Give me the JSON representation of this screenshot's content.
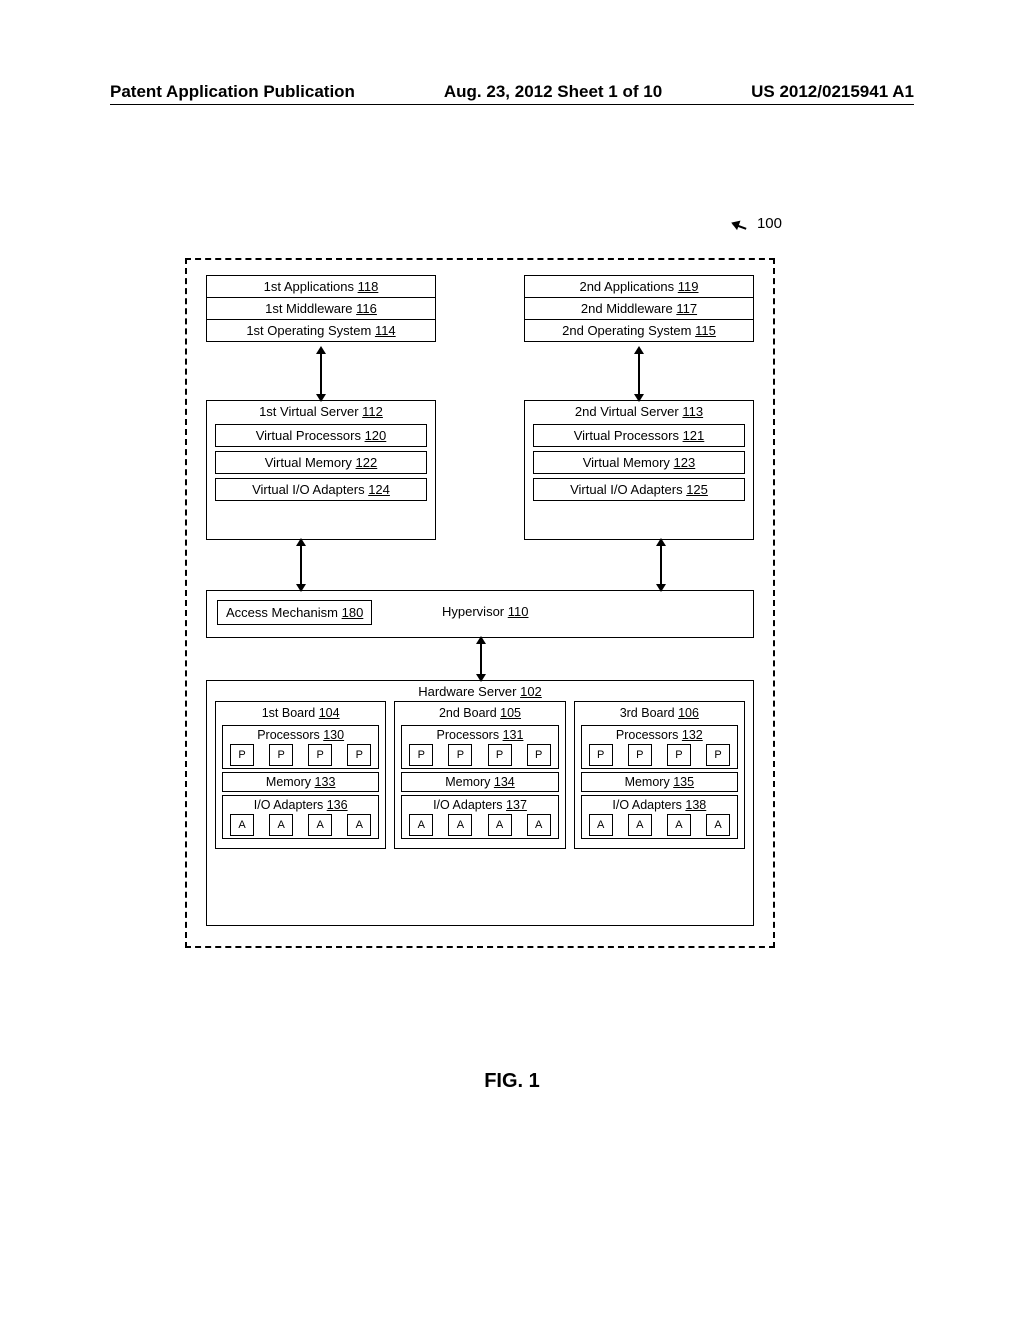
{
  "header": {
    "left": "Patent Application Publication",
    "center": "Aug. 23, 2012  Sheet 1 of 10",
    "right": "US 2012/0215941 A1"
  },
  "ref100": "100",
  "figure_label": "FIG. 1",
  "stacks": {
    "left": {
      "apps": {
        "label": "1st Applications",
        "num": "118"
      },
      "mw": {
        "label": "1st Middleware",
        "num": "116"
      },
      "os": {
        "label": "1st Operating System",
        "num": "114"
      }
    },
    "right": {
      "apps": {
        "label": "2nd Applications",
        "num": "119"
      },
      "mw": {
        "label": "2nd Middleware",
        "num": "117"
      },
      "os": {
        "label": "2nd Operating System",
        "num": "115"
      }
    }
  },
  "vservers": {
    "left": {
      "title": {
        "label": "1st Virtual Server",
        "num": "112"
      },
      "vp": {
        "label": "Virtual Processors",
        "num": "120"
      },
      "vm": {
        "label": "Virtual Memory",
        "num": "122"
      },
      "vio": {
        "label": "Virtual I/O Adapters",
        "num": "124"
      }
    },
    "right": {
      "title": {
        "label": "2nd Virtual Server",
        "num": "113"
      },
      "vp": {
        "label": "Virtual Processors",
        "num": "121"
      },
      "vm": {
        "label": "Virtual Memory",
        "num": "123"
      },
      "vio": {
        "label": "Virtual I/O Adapters",
        "num": "125"
      }
    }
  },
  "hypervisor": {
    "am": {
      "label": "Access Mechanism",
      "num": "180"
    },
    "label": "Hypervisor",
    "num": "110"
  },
  "hardware": {
    "title": {
      "label": "Hardware Server",
      "num": "102"
    },
    "boards": [
      {
        "name": {
          "label": "1st Board",
          "num": "104"
        },
        "proc": {
          "label": "Processors",
          "num": "130"
        },
        "mem": {
          "label": "Memory",
          "num": "133"
        },
        "io": {
          "label": "I/O Adapters",
          "num": "136"
        }
      },
      {
        "name": {
          "label": "2nd Board",
          "num": "105"
        },
        "proc": {
          "label": "Processors",
          "num": "131"
        },
        "mem": {
          "label": "Memory",
          "num": "134"
        },
        "io": {
          "label": "I/O Adapters",
          "num": "137"
        }
      },
      {
        "name": {
          "label": "3rd Board",
          "num": "106"
        },
        "proc": {
          "label": "Processors",
          "num": "132"
        },
        "mem": {
          "label": "Memory",
          "num": "135"
        },
        "io": {
          "label": "I/O Adapters",
          "num": "138"
        }
      }
    ],
    "p_glyph": "P",
    "a_glyph": "A"
  }
}
